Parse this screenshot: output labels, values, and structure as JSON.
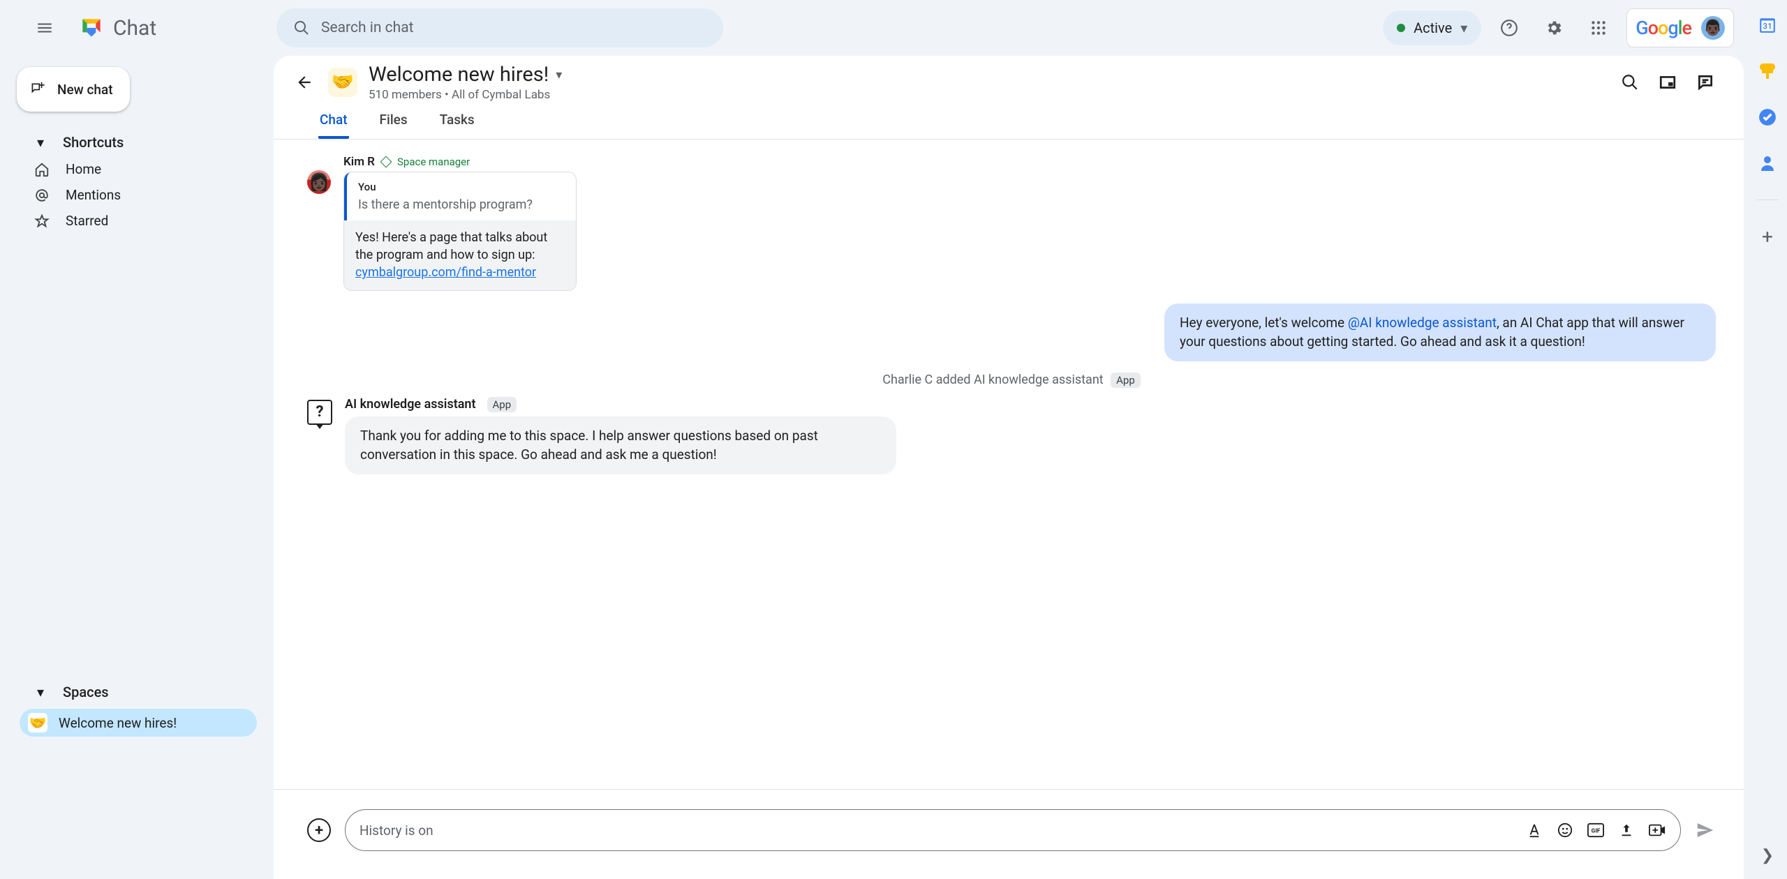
{
  "app": {
    "name": "Chat"
  },
  "search": {
    "placeholder": "Search in chat"
  },
  "status": {
    "label": "Active"
  },
  "newChat": {
    "label": "New chat"
  },
  "sidebar": {
    "sections": [
      {
        "label": "Shortcuts",
        "items": [
          {
            "label": "Home",
            "icon": "home"
          },
          {
            "label": "Mentions",
            "icon": "at"
          },
          {
            "label": "Starred",
            "icon": "star"
          }
        ]
      },
      {
        "label": "Spaces",
        "items": [
          {
            "label": "Welcome new hires!",
            "emoji": "🤝",
            "active": true
          }
        ]
      }
    ]
  },
  "space": {
    "emoji": "🤝",
    "title": "Welcome new hires!",
    "subtitle": "510 members  •  All of Cymbal Labs",
    "tabs": [
      "Chat",
      "Files",
      "Tasks"
    ],
    "activeTab": 0
  },
  "messages": {
    "kim": {
      "sender": "Kim R",
      "role": "Space manager",
      "quote": {
        "from": "You",
        "text": "Is there a mentorship program?"
      },
      "reply_prefix": "Yes! Here's a page that talks about the program and how to sign up: ",
      "reply_link": "cymbalgroup.com/find-a-mentor"
    },
    "you": {
      "prefix": "Hey everyone, let's welcome ",
      "mention": "@AI knowledge assistant",
      "suffix": ", an AI Chat app that will answer your questions about getting started.  Go ahead and ask it a question!"
    },
    "system": {
      "text": "Charlie C added AI knowledge assistant",
      "tag": "App"
    },
    "app": {
      "sender": "AI knowledge assistant",
      "tag": "App",
      "text": "Thank you for adding me to this space. I help answer questions based on past conversation in this space. Go ahead and ask me a question!"
    }
  },
  "composer": {
    "placeholder": "History is on"
  },
  "google": {
    "word": "Google"
  }
}
